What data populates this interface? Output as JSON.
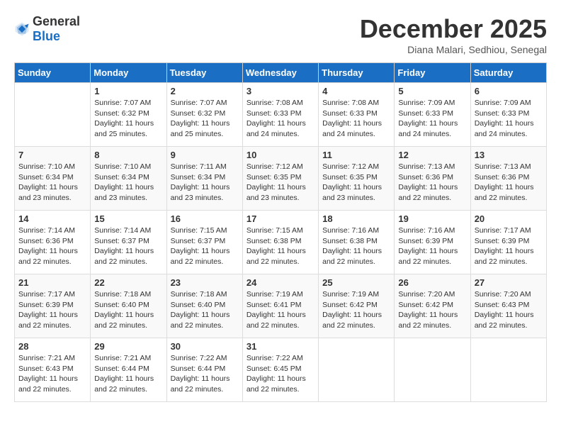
{
  "logo": {
    "general": "General",
    "blue": "Blue"
  },
  "title": "December 2025",
  "location": "Diana Malari, Sedhiou, Senegal",
  "days_header": [
    "Sunday",
    "Monday",
    "Tuesday",
    "Wednesday",
    "Thursday",
    "Friday",
    "Saturday"
  ],
  "weeks": [
    [
      {
        "day": "",
        "sunrise": "",
        "sunset": "",
        "daylight": ""
      },
      {
        "day": "1",
        "sunrise": "Sunrise: 7:07 AM",
        "sunset": "Sunset: 6:32 PM",
        "daylight": "Daylight: 11 hours and 25 minutes."
      },
      {
        "day": "2",
        "sunrise": "Sunrise: 7:07 AM",
        "sunset": "Sunset: 6:32 PM",
        "daylight": "Daylight: 11 hours and 25 minutes."
      },
      {
        "day": "3",
        "sunrise": "Sunrise: 7:08 AM",
        "sunset": "Sunset: 6:33 PM",
        "daylight": "Daylight: 11 hours and 24 minutes."
      },
      {
        "day": "4",
        "sunrise": "Sunrise: 7:08 AM",
        "sunset": "Sunset: 6:33 PM",
        "daylight": "Daylight: 11 hours and 24 minutes."
      },
      {
        "day": "5",
        "sunrise": "Sunrise: 7:09 AM",
        "sunset": "Sunset: 6:33 PM",
        "daylight": "Daylight: 11 hours and 24 minutes."
      },
      {
        "day": "6",
        "sunrise": "Sunrise: 7:09 AM",
        "sunset": "Sunset: 6:33 PM",
        "daylight": "Daylight: 11 hours and 24 minutes."
      }
    ],
    [
      {
        "day": "7",
        "sunrise": "Sunrise: 7:10 AM",
        "sunset": "Sunset: 6:34 PM",
        "daylight": "Daylight: 11 hours and 23 minutes."
      },
      {
        "day": "8",
        "sunrise": "Sunrise: 7:10 AM",
        "sunset": "Sunset: 6:34 PM",
        "daylight": "Daylight: 11 hours and 23 minutes."
      },
      {
        "day": "9",
        "sunrise": "Sunrise: 7:11 AM",
        "sunset": "Sunset: 6:34 PM",
        "daylight": "Daylight: 11 hours and 23 minutes."
      },
      {
        "day": "10",
        "sunrise": "Sunrise: 7:12 AM",
        "sunset": "Sunset: 6:35 PM",
        "daylight": "Daylight: 11 hours and 23 minutes."
      },
      {
        "day": "11",
        "sunrise": "Sunrise: 7:12 AM",
        "sunset": "Sunset: 6:35 PM",
        "daylight": "Daylight: 11 hours and 23 minutes."
      },
      {
        "day": "12",
        "sunrise": "Sunrise: 7:13 AM",
        "sunset": "Sunset: 6:36 PM",
        "daylight": "Daylight: 11 hours and 22 minutes."
      },
      {
        "day": "13",
        "sunrise": "Sunrise: 7:13 AM",
        "sunset": "Sunset: 6:36 PM",
        "daylight": "Daylight: 11 hours and 22 minutes."
      }
    ],
    [
      {
        "day": "14",
        "sunrise": "Sunrise: 7:14 AM",
        "sunset": "Sunset: 6:36 PM",
        "daylight": "Daylight: 11 hours and 22 minutes."
      },
      {
        "day": "15",
        "sunrise": "Sunrise: 7:14 AM",
        "sunset": "Sunset: 6:37 PM",
        "daylight": "Daylight: 11 hours and 22 minutes."
      },
      {
        "day": "16",
        "sunrise": "Sunrise: 7:15 AM",
        "sunset": "Sunset: 6:37 PM",
        "daylight": "Daylight: 11 hours and 22 minutes."
      },
      {
        "day": "17",
        "sunrise": "Sunrise: 7:15 AM",
        "sunset": "Sunset: 6:38 PM",
        "daylight": "Daylight: 11 hours and 22 minutes."
      },
      {
        "day": "18",
        "sunrise": "Sunrise: 7:16 AM",
        "sunset": "Sunset: 6:38 PM",
        "daylight": "Daylight: 11 hours and 22 minutes."
      },
      {
        "day": "19",
        "sunrise": "Sunrise: 7:16 AM",
        "sunset": "Sunset: 6:39 PM",
        "daylight": "Daylight: 11 hours and 22 minutes."
      },
      {
        "day": "20",
        "sunrise": "Sunrise: 7:17 AM",
        "sunset": "Sunset: 6:39 PM",
        "daylight": "Daylight: 11 hours and 22 minutes."
      }
    ],
    [
      {
        "day": "21",
        "sunrise": "Sunrise: 7:17 AM",
        "sunset": "Sunset: 6:39 PM",
        "daylight": "Daylight: 11 hours and 22 minutes."
      },
      {
        "day": "22",
        "sunrise": "Sunrise: 7:18 AM",
        "sunset": "Sunset: 6:40 PM",
        "daylight": "Daylight: 11 hours and 22 minutes."
      },
      {
        "day": "23",
        "sunrise": "Sunrise: 7:18 AM",
        "sunset": "Sunset: 6:40 PM",
        "daylight": "Daylight: 11 hours and 22 minutes."
      },
      {
        "day": "24",
        "sunrise": "Sunrise: 7:19 AM",
        "sunset": "Sunset: 6:41 PM",
        "daylight": "Daylight: 11 hours and 22 minutes."
      },
      {
        "day": "25",
        "sunrise": "Sunrise: 7:19 AM",
        "sunset": "Sunset: 6:42 PM",
        "daylight": "Daylight: 11 hours and 22 minutes."
      },
      {
        "day": "26",
        "sunrise": "Sunrise: 7:20 AM",
        "sunset": "Sunset: 6:42 PM",
        "daylight": "Daylight: 11 hours and 22 minutes."
      },
      {
        "day": "27",
        "sunrise": "Sunrise: 7:20 AM",
        "sunset": "Sunset: 6:43 PM",
        "daylight": "Daylight: 11 hours and 22 minutes."
      }
    ],
    [
      {
        "day": "28",
        "sunrise": "Sunrise: 7:21 AM",
        "sunset": "Sunset: 6:43 PM",
        "daylight": "Daylight: 11 hours and 22 minutes."
      },
      {
        "day": "29",
        "sunrise": "Sunrise: 7:21 AM",
        "sunset": "Sunset: 6:44 PM",
        "daylight": "Daylight: 11 hours and 22 minutes."
      },
      {
        "day": "30",
        "sunrise": "Sunrise: 7:22 AM",
        "sunset": "Sunset: 6:44 PM",
        "daylight": "Daylight: 11 hours and 22 minutes."
      },
      {
        "day": "31",
        "sunrise": "Sunrise: 7:22 AM",
        "sunset": "Sunset: 6:45 PM",
        "daylight": "Daylight: 11 hours and 22 minutes."
      },
      {
        "day": "",
        "sunrise": "",
        "sunset": "",
        "daylight": ""
      },
      {
        "day": "",
        "sunrise": "",
        "sunset": "",
        "daylight": ""
      },
      {
        "day": "",
        "sunrise": "",
        "sunset": "",
        "daylight": ""
      }
    ]
  ]
}
